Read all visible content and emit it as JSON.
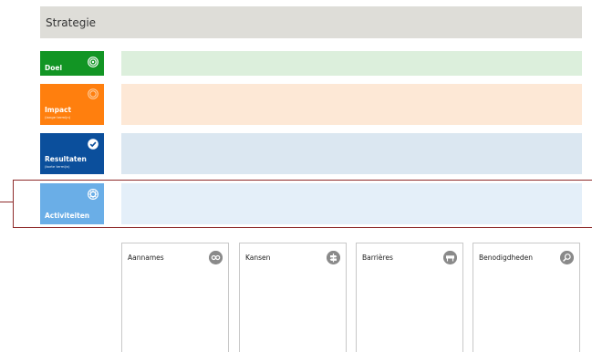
{
  "header": {
    "title": "Strategie"
  },
  "tiles": {
    "doel": {
      "label": "Doel",
      "color": "#129524",
      "bar": "#dcefdc",
      "icon": "target-icon"
    },
    "impact": {
      "label": "Impact",
      "sub": "(lange termijn)",
      "color": "#ff7f0e",
      "bar": "#fde8d6",
      "icon": "target-outline-icon"
    },
    "resultaten": {
      "label": "Resultaten",
      "sub": "(korte termijn)",
      "color": "#0b4f9c",
      "bar": "#dbe7f1",
      "icon": "check-circle-icon"
    },
    "activiteiten": {
      "label": "Activiteiten",
      "color": "#6aaee7",
      "bar": "#e4eff9",
      "icon": "gear-icon"
    }
  },
  "cards": [
    {
      "title": "Aannames",
      "icon": "infinity-icon"
    },
    {
      "title": "Kansen",
      "icon": "signpost-icon"
    },
    {
      "title": "Barrières",
      "icon": "barrier-icon"
    },
    {
      "title": "Benodigdheden",
      "icon": "search-gear-icon"
    }
  ],
  "highlight_color": "#8e2b2b"
}
